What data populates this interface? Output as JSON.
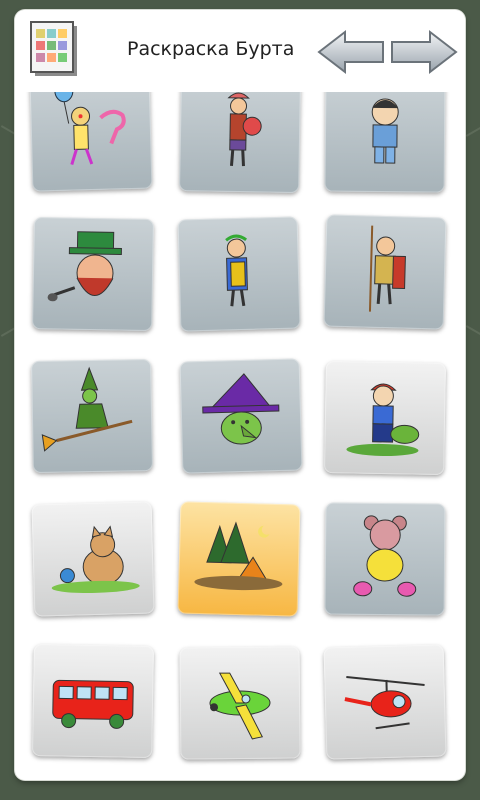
{
  "header": {
    "title": "Раскраска Бурта",
    "gallery_icon": "gallery-grid-icon",
    "prev_icon": "arrow-left-icon",
    "next_icon": "arrow-right-icon"
  },
  "tiles": [
    {
      "icon": "clown-with-balloon-icon"
    },
    {
      "icon": "roman-soldier-icon"
    },
    {
      "icon": "asian-boy-icon"
    },
    {
      "icon": "leprechaun-icon"
    },
    {
      "icon": "roman-emperor-icon"
    },
    {
      "icon": "gaul-warrior-icon"
    },
    {
      "icon": "witch-on-broom-icon"
    },
    {
      "icon": "witch-face-icon"
    },
    {
      "icon": "boy-with-turtle-icon"
    },
    {
      "icon": "cat-with-snail-icon"
    },
    {
      "icon": "camping-tent-icon"
    },
    {
      "icon": "teddy-bear-icon"
    },
    {
      "icon": "red-bus-icon"
    },
    {
      "icon": "green-airplane-icon"
    },
    {
      "icon": "red-helicopter-icon"
    }
  ],
  "colors": {
    "background": "#4b5a48",
    "panel": "#ffffff",
    "tile": "#b7c1c6",
    "tile_highlight": "#f7b743"
  }
}
